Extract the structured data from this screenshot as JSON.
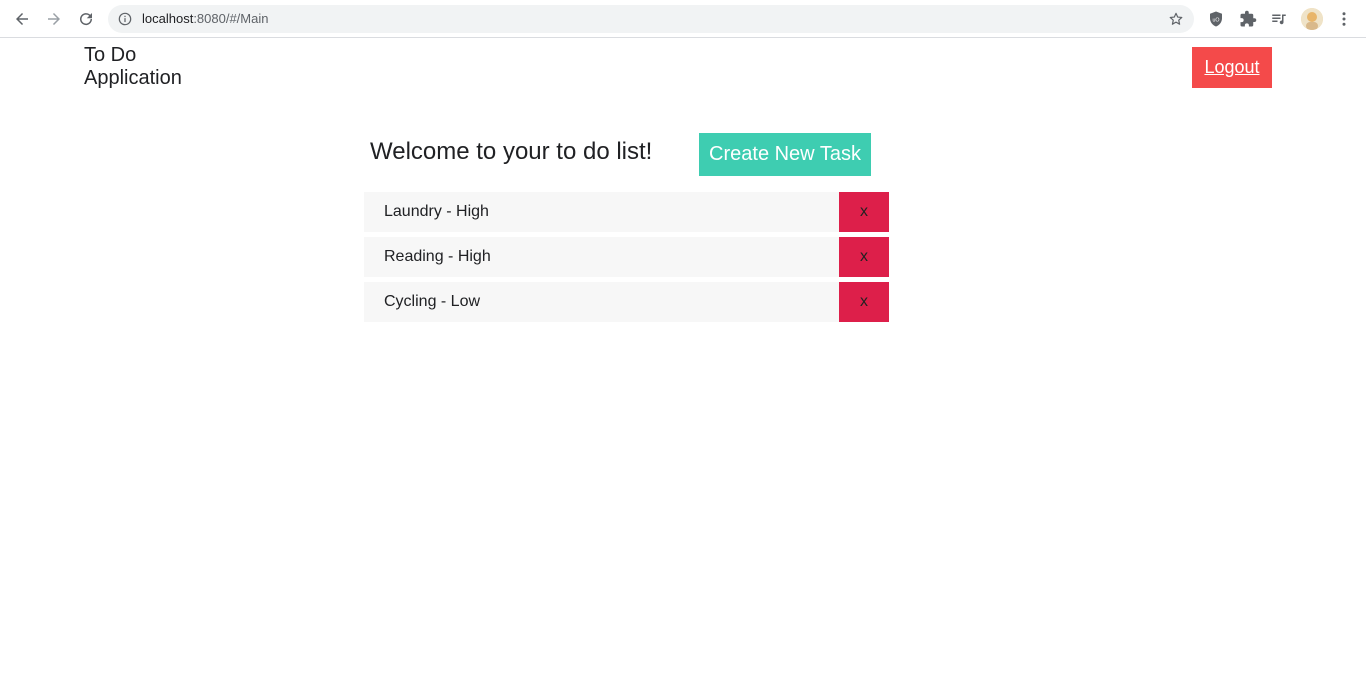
{
  "browser": {
    "url_host": "localhost",
    "url_path": ":8080/#/Main"
  },
  "header": {
    "title_line1": "To Do",
    "title_line2": "Application",
    "logout_label": "Logout"
  },
  "main": {
    "welcome_text": "Welcome to your to do list!",
    "create_label": "Create New Task",
    "tasks": [
      {
        "label": "Laundry - High",
        "delete_label": "x"
      },
      {
        "label": "Reading - High",
        "delete_label": "x"
      },
      {
        "label": "Cycling - Low",
        "delete_label": "x"
      }
    ]
  },
  "colors": {
    "logout": "#f44a4a",
    "create": "#3ecdb1",
    "delete": "#dd1f4a",
    "task_bg": "#f7f7f7"
  },
  "icons": {
    "back": "arrow-left-icon",
    "forward": "arrow-right-icon",
    "reload": "reload-icon",
    "info": "info-icon",
    "bookmark": "star-icon",
    "extension1": "shield-icon",
    "extension2": "puzzle-icon",
    "media": "playlist-icon",
    "menu": "kebab-menu-icon"
  }
}
